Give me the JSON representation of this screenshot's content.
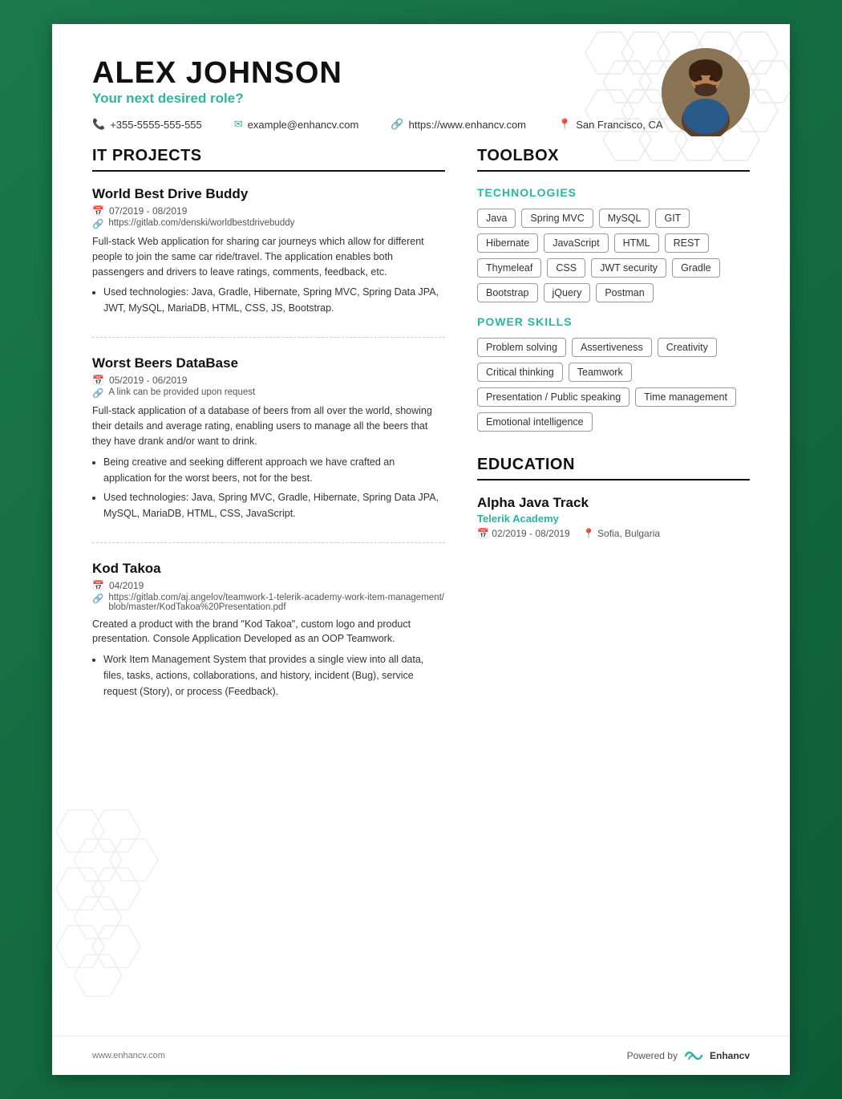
{
  "header": {
    "name": "ALEX JOHNSON",
    "role": "Your next desired role?",
    "phone": "+355-5555-555-555",
    "website": "https://www.enhancv.com",
    "email": "example@enhancv.com",
    "location": "San Francisco, CA"
  },
  "sections": {
    "it_projects": {
      "title": "IT PROJECTS",
      "projects": [
        {
          "title": "World Best Drive Buddy",
          "date": "07/2019 - 08/2019",
          "link": "https://gitlab.com/denski/worldbestdrivebuddy",
          "description": "Full-stack Web application for sharing car journeys which allow for different people to join the same car ride/travel. The application enables both passengers and drivers to leave ratings, comments, feedback, etc.",
          "bullets": [
            "Used technologies: Java, Gradle, Hibernate, Spring MVC, Spring Data JPA, JWT, MySQL, MariaDB, HTML, CSS, JS, Bootstrap."
          ]
        },
        {
          "title": "Worst Beers DataBase",
          "date": "05/2019 - 06/2019",
          "link": "A link can be provided upon request",
          "description": "Full-stack application of a database of beers from all over the world, showing their details and average rating, enabling users to manage all the beers that they have drank and/or want to drink.",
          "bullets": [
            "Being creative and seeking different approach we have crafted an application for the worst beers, not for the best.",
            "Used technologies: Java, Spring MVC, Gradle, Hibernate, Spring Data JPA, MySQL, MariaDB, HTML, CSS, JavaScript."
          ]
        },
        {
          "title": "Kod Takoa",
          "date": "04/2019",
          "link": "https://gitlab.com/aj.angelov/teamwork-1-telerik-academy-work-item-management/blob/master/KodTakoa%20Presentation.pdf",
          "description": "Created a product with the brand \"Kod Takoa\", custom logo and product presentation. Console Application Developed as an OOP Teamwork.",
          "bullets": [
            "Work Item Management System that provides a single view into all data, files, tasks, actions, collaborations, and history, incident (Bug), service request (Story), or process (Feedback)."
          ]
        }
      ]
    },
    "toolbox": {
      "title": "TOOLBOX",
      "technologies": {
        "label": "TECHNOLOGIES",
        "tags": [
          "Java",
          "Spring MVC",
          "MySQL",
          "GIT",
          "Hibernate",
          "JavaScript",
          "HTML",
          "REST",
          "Thymeleaf",
          "CSS",
          "JWT security",
          "Gradle",
          "Bootstrap",
          "jQuery",
          "Postman"
        ]
      },
      "power_skills": {
        "label": "POWER SKILLS",
        "tags": [
          "Problem solving",
          "Assertiveness",
          "Creativity",
          "Critical thinking",
          "Teamwork",
          "Presentation / Public speaking",
          "Time management",
          "Emotional intelligence"
        ]
      }
    },
    "education": {
      "title": "EDUCATION",
      "items": [
        {
          "degree": "Alpha Java Track",
          "school": "Telerik Academy",
          "date": "02/2019 - 08/2019",
          "location": "Sofia, Bulgaria"
        }
      ]
    }
  },
  "footer": {
    "website": "www.enhancv.com",
    "powered_by": "Powered by",
    "brand": "Enhancv"
  }
}
